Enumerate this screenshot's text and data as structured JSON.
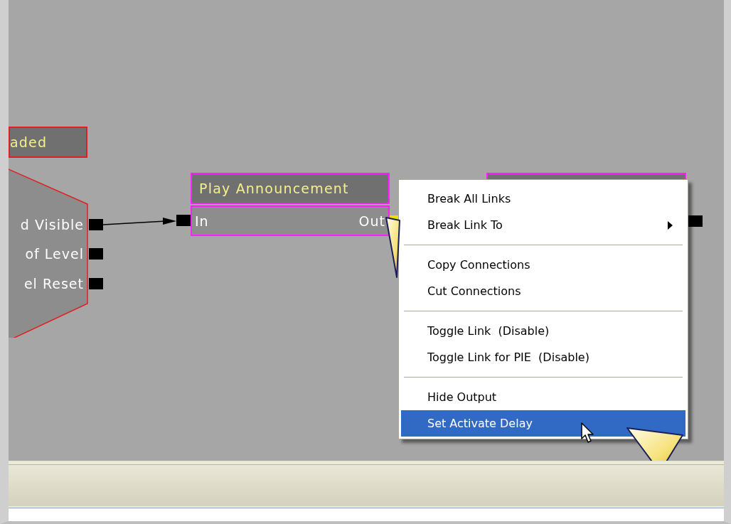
{
  "canvas": {
    "nodes": [
      {
        "kind": "event",
        "title": "aded"
      },
      {
        "kind": "hub",
        "outputs": [
          {
            "label": "d Visible"
          },
          {
            "label": "of Level"
          },
          {
            "label": "el Reset"
          }
        ]
      },
      {
        "kind": "action",
        "title": "Play Announcement",
        "input": "In",
        "output": "Out",
        "output_selected": true
      }
    ]
  },
  "context_menu": {
    "items": [
      {
        "kind": "item",
        "label": "Break All Links",
        "submenu": false,
        "selected": false
      },
      {
        "kind": "item",
        "label": "Break Link To",
        "submenu": true,
        "selected": false
      },
      {
        "kind": "separator"
      },
      {
        "kind": "item",
        "label": "Copy Connections",
        "submenu": false,
        "selected": false
      },
      {
        "kind": "item",
        "label": "Cut Connections",
        "submenu": false,
        "selected": false
      },
      {
        "kind": "separator"
      },
      {
        "kind": "item",
        "label": "Toggle Link  (Disable)",
        "submenu": false,
        "selected": false
      },
      {
        "kind": "item",
        "label": "Toggle Link for PIE  (Disable)",
        "submenu": false,
        "selected": false
      },
      {
        "kind": "separator"
      },
      {
        "kind": "item",
        "label": "Hide Output",
        "submenu": false,
        "selected": false
      },
      {
        "kind": "item",
        "label": "Set Activate Delay",
        "submenu": false,
        "selected": true
      }
    ]
  }
}
